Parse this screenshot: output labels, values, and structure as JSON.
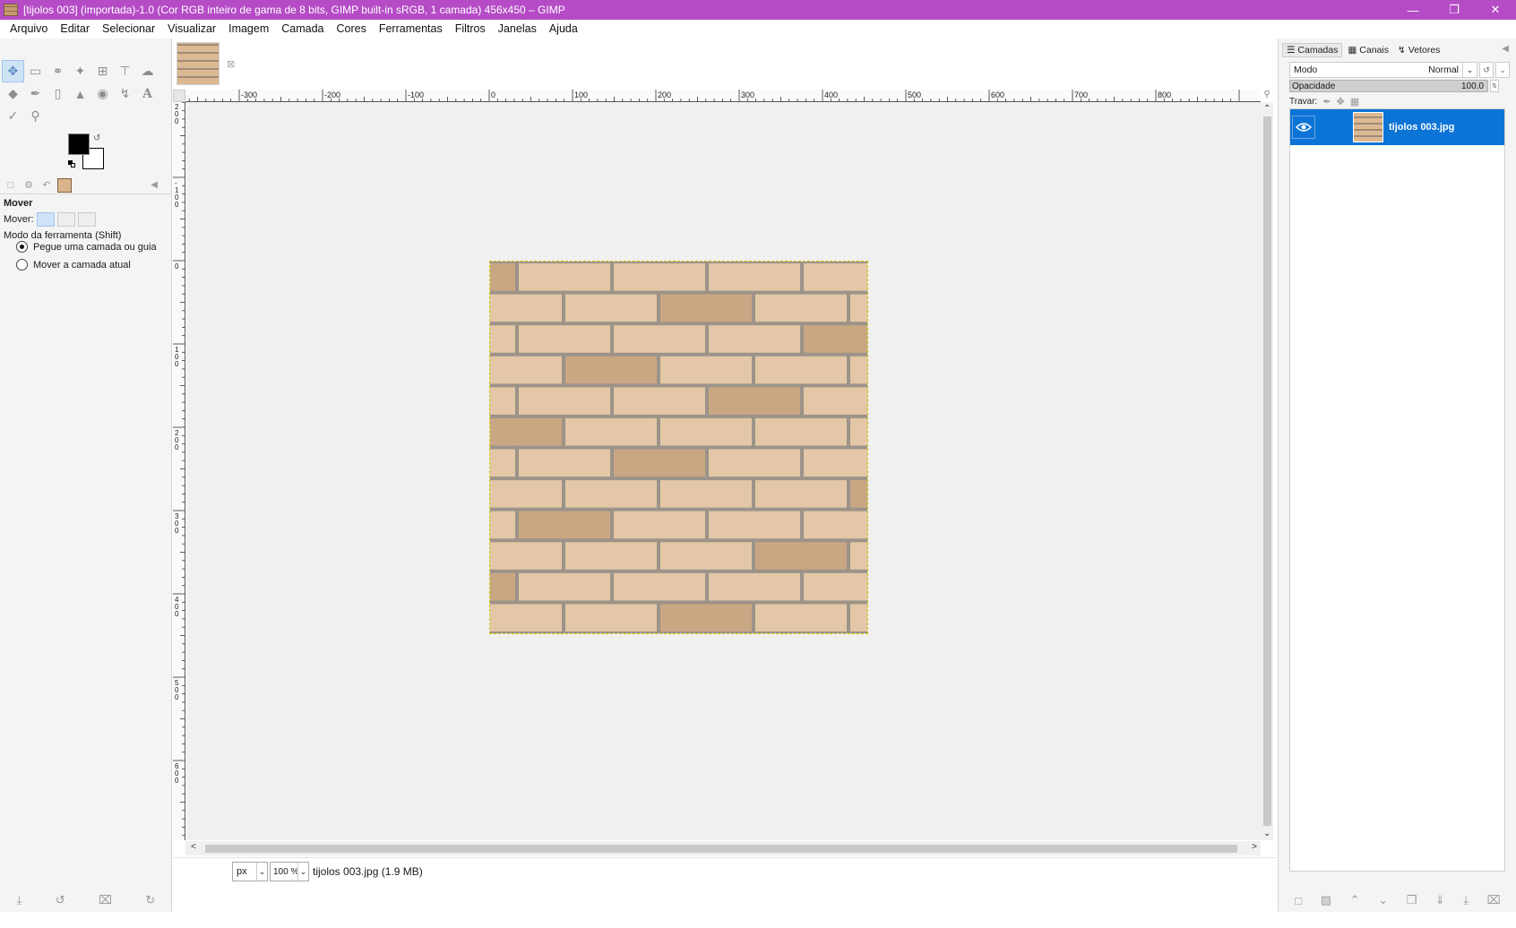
{
  "window": {
    "title": "[tijolos 003] (importada)-1.0 (Cor RGB inteiro de gama de 8 bits, GIMP built-in sRGB, 1 camada) 456x450 – GIMP",
    "controls": [
      "minimize-icon",
      "restore-icon",
      "close-icon"
    ]
  },
  "menu": [
    "Arquivo",
    "Editar",
    "Selecionar",
    "Visualizar",
    "Imagem",
    "Camada",
    "Cores",
    "Ferramentas",
    "Filtros",
    "Janelas",
    "Ajuda"
  ],
  "toolbox": {
    "tools": [
      "move-tool-icon",
      "rect-select-icon",
      "lasso-icon",
      "fuzzy-select-icon",
      "crop-icon",
      "unified-transform-icon",
      "warp-transform-icon",
      "bucket-fill-icon",
      "paintbrush-icon",
      "eraser-icon",
      "clone-icon",
      "smudge-icon",
      "paths-icon",
      "text-tool-icon",
      "color-picker-icon",
      "zoom-tool-icon"
    ],
    "active_tool": "move-tool-icon",
    "foreground_color": "#000000",
    "background_color": "#ffffff",
    "options": {
      "title": "Mover",
      "move_label": "Mover:",
      "mode_label": "Modo da ferramenta (Shift)",
      "radio_1": "Pegue uma camada ou guia",
      "radio_2": "Mover a camada atual",
      "selected_radio": 1
    }
  },
  "canvas": {
    "ruler_h_labels": [
      "-300",
      "-200",
      "-100",
      "0",
      "100",
      "200",
      "300",
      "400",
      "500",
      "600",
      "700",
      "800"
    ],
    "ruler_v_labels": [
      "-200",
      "-100",
      "0",
      "100",
      "200",
      "300",
      "400",
      "500",
      "600"
    ],
    "image_colors": {
      "brick_light": "#e3c7a6",
      "brick_dark": "#c9a783",
      "mortar": "#9c9389"
    }
  },
  "status": {
    "unit": "px",
    "zoom": "100 %",
    "file_info": "tijolos 003.jpg (1.9 MB)"
  },
  "layers_panel": {
    "tabs": [
      "Camadas",
      "Canais",
      "Vetores"
    ],
    "mode_label": "Modo",
    "mode_value": "Normal",
    "opacity_label": "Opacidade",
    "opacity_value": "100.0",
    "lock_label": "Travar:",
    "layers": [
      {
        "name": "tijolos 003.jpg",
        "visible": true,
        "selected": true
      }
    ],
    "accent": "#0c74d6"
  }
}
